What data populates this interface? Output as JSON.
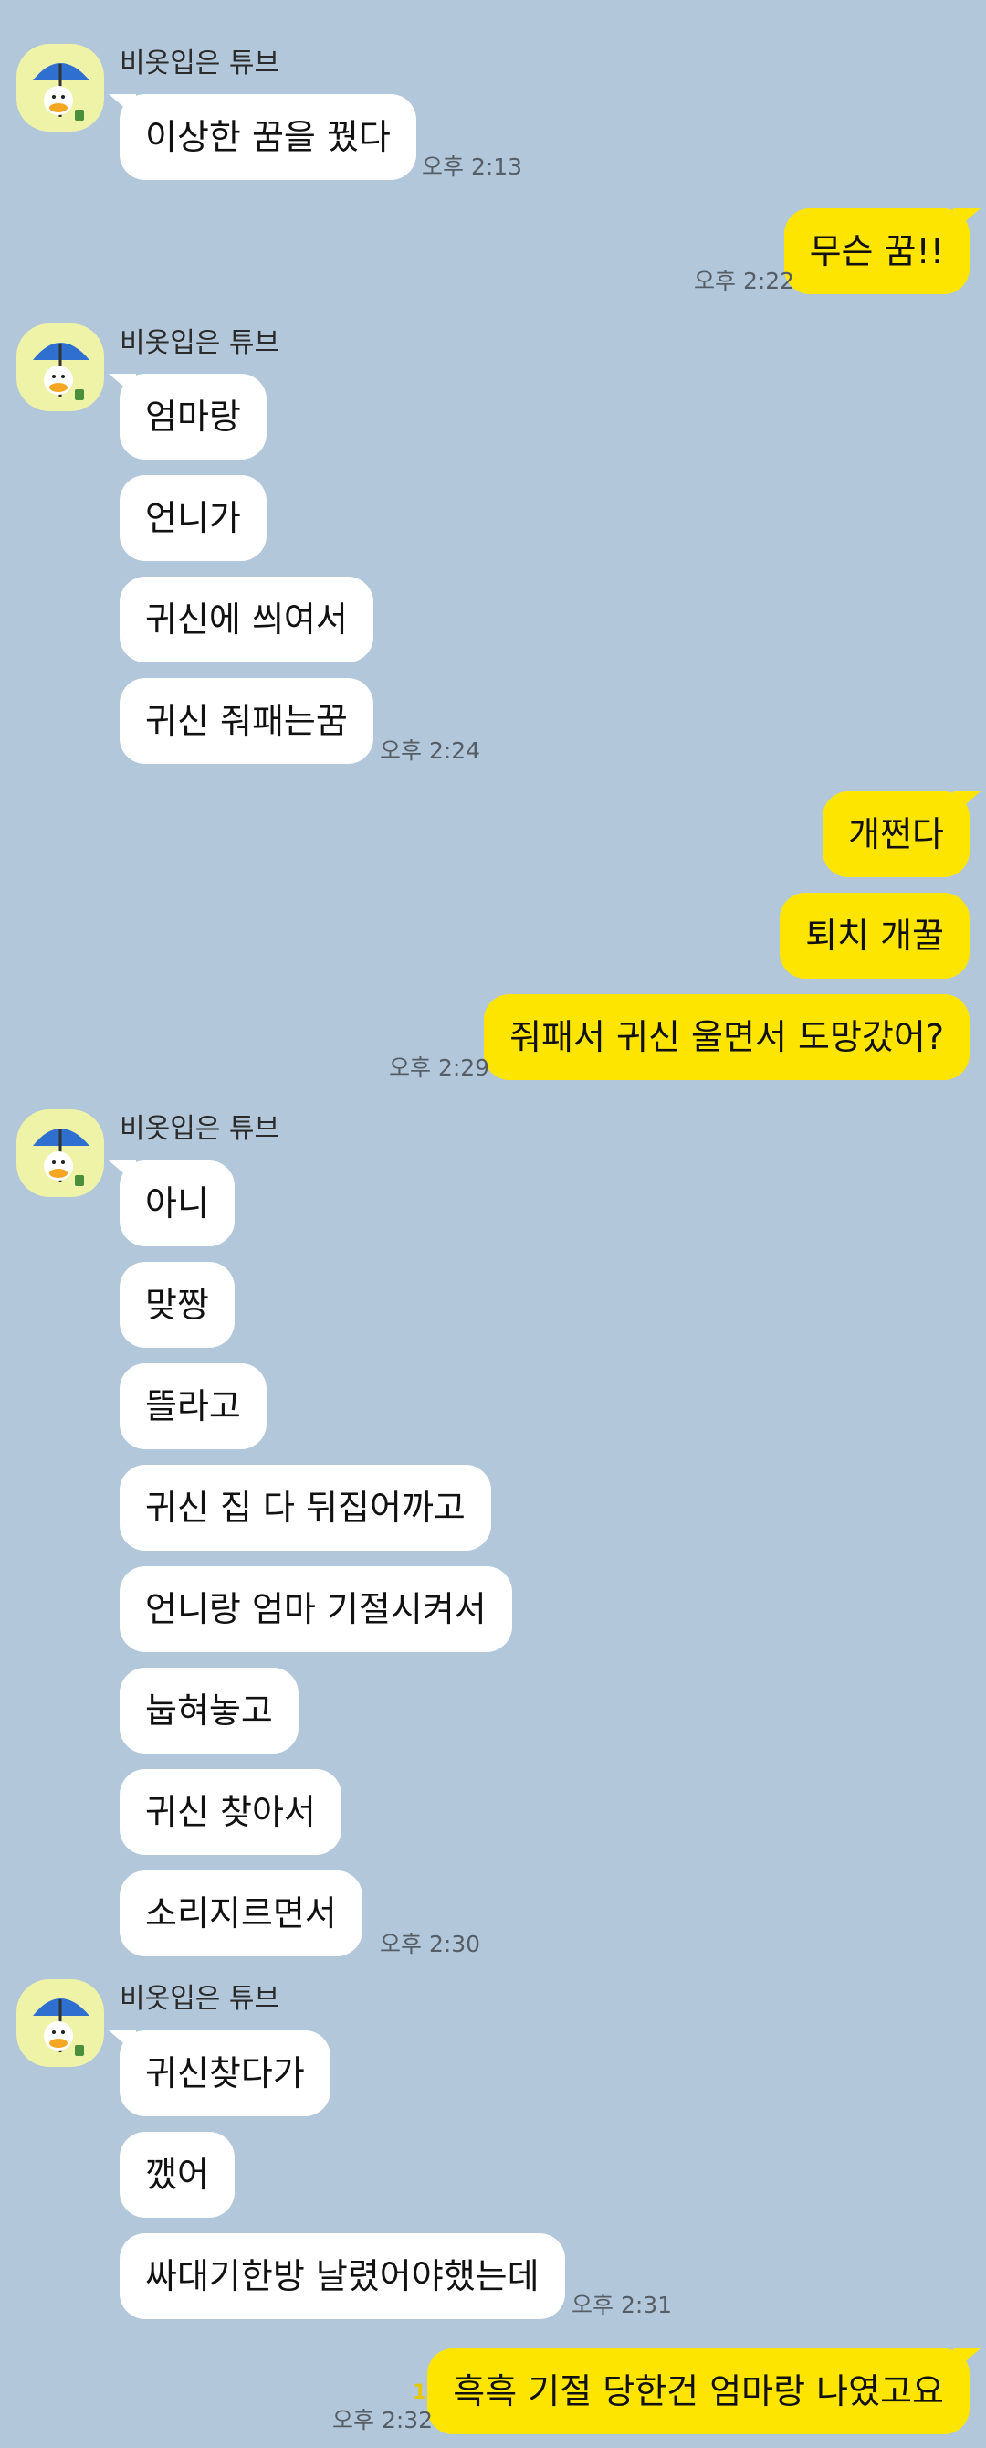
{
  "colors": {
    "background": "#b2c7da",
    "incoming": "#ffffff",
    "outgoing": "#fee500",
    "avatar_bg": "#eef3a8",
    "unread": "#e8c800"
  },
  "sender_name": "비옷입은 튜브",
  "messages": [
    {
      "text": "이상한 꿈을 꿨다"
    },
    {
      "text": "무슨 꿈!!"
    },
    {
      "text": "엄마랑"
    },
    {
      "text": "언니가"
    },
    {
      "text": "귀신에 씌여서"
    },
    {
      "text": "귀신 줘패는꿈"
    },
    {
      "text": "개쩐다"
    },
    {
      "text": "퇴치 개꿀"
    },
    {
      "text": "줘패서 귀신 울면서 도망갔어?"
    },
    {
      "text": "아니"
    },
    {
      "text": "맞짱"
    },
    {
      "text": "뜰라고"
    },
    {
      "text": "귀신 집 다 뒤집어까고"
    },
    {
      "text": "언니랑 엄마 기절시켜서"
    },
    {
      "text": "눕혀놓고"
    },
    {
      "text": "귀신 찾아서"
    },
    {
      "text": "소리지르면서"
    },
    {
      "text": "귀신찾다가"
    },
    {
      "text": "깼어"
    },
    {
      "text": "싸대기한방 날렸어야했는데"
    },
    {
      "text": "흑흑 기절 당한건 엄마랑 나였고요",
      "unread": "1"
    }
  ],
  "times": [
    "오후 2:13",
    "오후 2:22",
    "오후 2:24",
    "오후 2:29",
    "오후 2:30",
    "오후 2:31",
    "오후 2:32"
  ]
}
